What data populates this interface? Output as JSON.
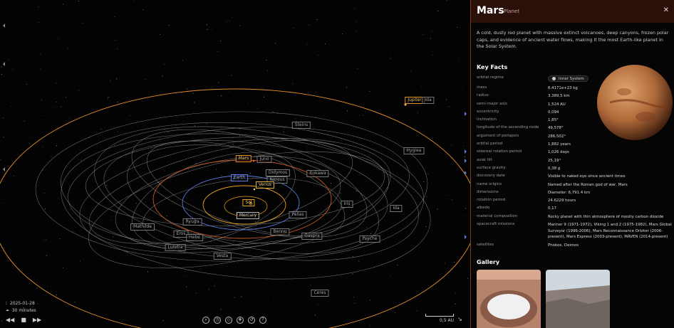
{
  "viewport": {
    "labels": [
      {
        "name": "label-jupiter",
        "text": "Jupiter",
        "cls": "ringed"
      },
      {
        "name": "label-ida",
        "text": "Ida",
        "cls": ""
      },
      {
        "name": "label-stains",
        "text": "Steins",
        "cls": ""
      },
      {
        "name": "label-hygiea",
        "text": "Hygiea",
        "cls": ""
      },
      {
        "name": "label-mars",
        "text": "Mars",
        "cls": "ringed"
      },
      {
        "name": "label-juno",
        "text": "Juno",
        "cls": ""
      },
      {
        "name": "label-didymos",
        "text": "Didymos",
        "cls": ""
      },
      {
        "name": "label-itokawa",
        "text": "Itokawa",
        "cls": ""
      },
      {
        "name": "label-earth",
        "text": "Earth",
        "cls": "earth"
      },
      {
        "name": "label-nereus",
        "text": "Nereus",
        "cls": ""
      },
      {
        "name": "label-venus",
        "text": "Venus",
        "cls": "venus"
      },
      {
        "name": "label-sol",
        "text": "Sol",
        "cls": "sun"
      },
      {
        "name": "label-mercury",
        "text": "Mercury",
        "cls": "mercury"
      },
      {
        "name": "label-iris",
        "text": "Iris",
        "cls": ""
      },
      {
        "name": "label-ida-2",
        "text": "Ida",
        "cls": ""
      },
      {
        "name": "label-pallas",
        "text": "Pallas",
        "cls": ""
      },
      {
        "name": "label-ryugu",
        "text": "Ryugu",
        "cls": ""
      },
      {
        "name": "label-mathilde",
        "text": "Mathilde",
        "cls": ""
      },
      {
        "name": "label-bennu",
        "text": "Bennu",
        "cls": ""
      },
      {
        "name": "label-gaspra",
        "text": "Gaspra",
        "cls": ""
      },
      {
        "name": "label-eros",
        "text": "Eros",
        "cls": ""
      },
      {
        "name": "label-hebe",
        "text": "Hebe",
        "cls": ""
      },
      {
        "name": "label-psyche",
        "text": "Psyche",
        "cls": ""
      },
      {
        "name": "label-lutetia",
        "text": "Lutetia",
        "cls": ""
      },
      {
        "name": "label-vesta",
        "text": "Vesta",
        "cls": ""
      },
      {
        "name": "label-ceres",
        "text": "Ceres",
        "cls": ""
      }
    ],
    "date": "2025-01-28",
    "time_step": "30 minutes",
    "scale_label": "0,5 AU",
    "colors": {
      "sun_orbit": "#e8a020",
      "earth_orbit": "#5a7ce0",
      "mars_orbit": "#d05a20",
      "asteroid_orbit": "#9a9a9a",
      "jupiter_orbit": "#e8922a"
    }
  },
  "toolbar": {
    "icons": [
      "search-icon",
      "clock-icon",
      "tag-icon",
      "layers-icon",
      "history-icon",
      "help-icon"
    ],
    "glyphs": [
      "⌕",
      "◷",
      "◇",
      "❖",
      "↺",
      "?"
    ]
  },
  "playback": {
    "rewind": "◀◀",
    "stop": "■",
    "forward": "▶▶"
  },
  "panel": {
    "title": "Mars",
    "subtitle": "Planet",
    "close": "✕",
    "description": "A cold, dusty red planet with massive extinct volcanoes, deep canyons, frozen polar caps, and evidence of ancient water flows, making it the most Earth-like planet in the Solar System.",
    "key_facts_heading": "Key Facts",
    "orbital_regime_label": "orbital regime",
    "orbital_regime_value": "Inner System",
    "facts": [
      {
        "k": "mass",
        "v": "6.4171e+23 kg"
      },
      {
        "k": "radius",
        "v": "3,389,5 km"
      },
      {
        "k": "semi-major axis",
        "v": "1,524 AU"
      },
      {
        "k": "eccentricity",
        "v": "0,094"
      },
      {
        "k": "inclination",
        "v": "1,85°"
      },
      {
        "k": "longitude of the ascending node",
        "v": "49,578°"
      },
      {
        "k": "argument of periapsis",
        "v": "286,502°"
      },
      {
        "k": "orbital period",
        "v": "1,882 years"
      },
      {
        "k": "sidereal rotation period",
        "v": "1,026 days"
      },
      {
        "k": "axial tilt",
        "v": "25,19°"
      },
      {
        "k": "surface gravity",
        "v": "0,38 g"
      },
      {
        "k": "discovery date",
        "v": "Visible to naked eye since ancient times"
      },
      {
        "k": "name origins",
        "v": "Named after the Roman god of war, Mars"
      },
      {
        "k": "dimensions",
        "v": "Diameter: 6,791.4 km"
      },
      {
        "k": "rotation period",
        "v": "24.6229 hours"
      },
      {
        "k": "albedo",
        "v": "0,17"
      },
      {
        "k": "material composition",
        "v": "Rocky planet with thin atmosphere of mostly carbon dioxide"
      },
      {
        "k": "spacecraft missions",
        "v": "Mariner 9 (1971-1972), Viking 1 and 2 (1975-1982), Mars Global Surveyor (1996-2006), Mars Reconnaissance Orbiter (2006-present), Mars Express (2003-present), MAVEN (2014-present)"
      },
      {
        "k": "satellites",
        "v": "Phobos, Deimos"
      }
    ],
    "gallery_heading": "Gallery"
  }
}
